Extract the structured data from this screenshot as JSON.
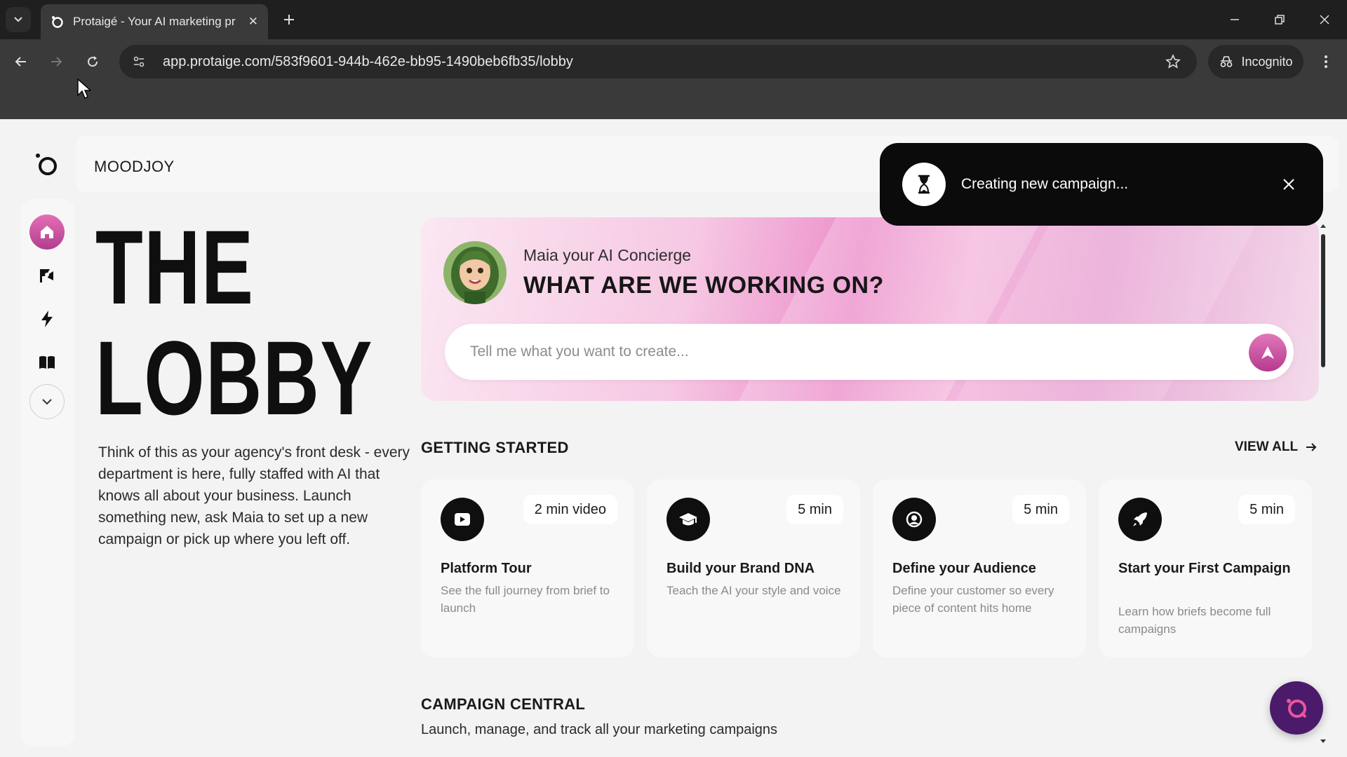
{
  "browser": {
    "tab_title": "Protaigé - Your AI marketing pr",
    "url": "app.protaige.com/583f9601-944b-462e-bb95-1490beb6fb35/lobby",
    "incognito_label": "Incognito"
  },
  "app": {
    "brand_name": "MOODJOY",
    "nav_items": [
      "home-icon",
      "campaign-flag-icon",
      "lightning-icon",
      "book-icon",
      "chevron-down-icon"
    ],
    "hero": {
      "title_line1": "THE",
      "title_line2": "LOBBY",
      "description": "Think of this as your agency's front desk - every department is here, fully staffed with AI that knows all about your business. Launch something new, ask Maia to set up a new campaign or pick up where you left off."
    },
    "concierge": {
      "label": "Maia your AI Concierge",
      "title": "WHAT ARE WE WORKING ON?",
      "input_placeholder": "Tell me what you want to create..."
    },
    "getting_started": {
      "title": "GETTING STARTED",
      "view_all": "VIEW ALL",
      "cards": [
        {
          "icon": "play-video-icon",
          "badge": "2 min video",
          "title": "Platform Tour",
          "description": "See the full journey from brief to launch"
        },
        {
          "icon": "graduation-cap-icon",
          "badge": "5 min",
          "title": "Build your Brand DNA",
          "description": "Teach the AI your style and voice"
        },
        {
          "icon": "audience-target-icon",
          "badge": "5 min",
          "title": "Define your Audience",
          "description": "Define your customer so every piece of content hits home"
        },
        {
          "icon": "rocket-icon",
          "badge": "5 min",
          "title": "Start your First Campaign",
          "description": "Learn how briefs become full campaigns"
        }
      ]
    },
    "campaign_central": {
      "title": "CAMPAIGN CENTRAL",
      "subtitle": "Launch, manage, and track all your marketing campaigns"
    },
    "toast": {
      "message": "Creating new campaign..."
    }
  },
  "colors": {
    "accent_pink": "#d9559f",
    "toast_bg": "#0b0b0b",
    "fab_purple": "#4b1a6a"
  }
}
